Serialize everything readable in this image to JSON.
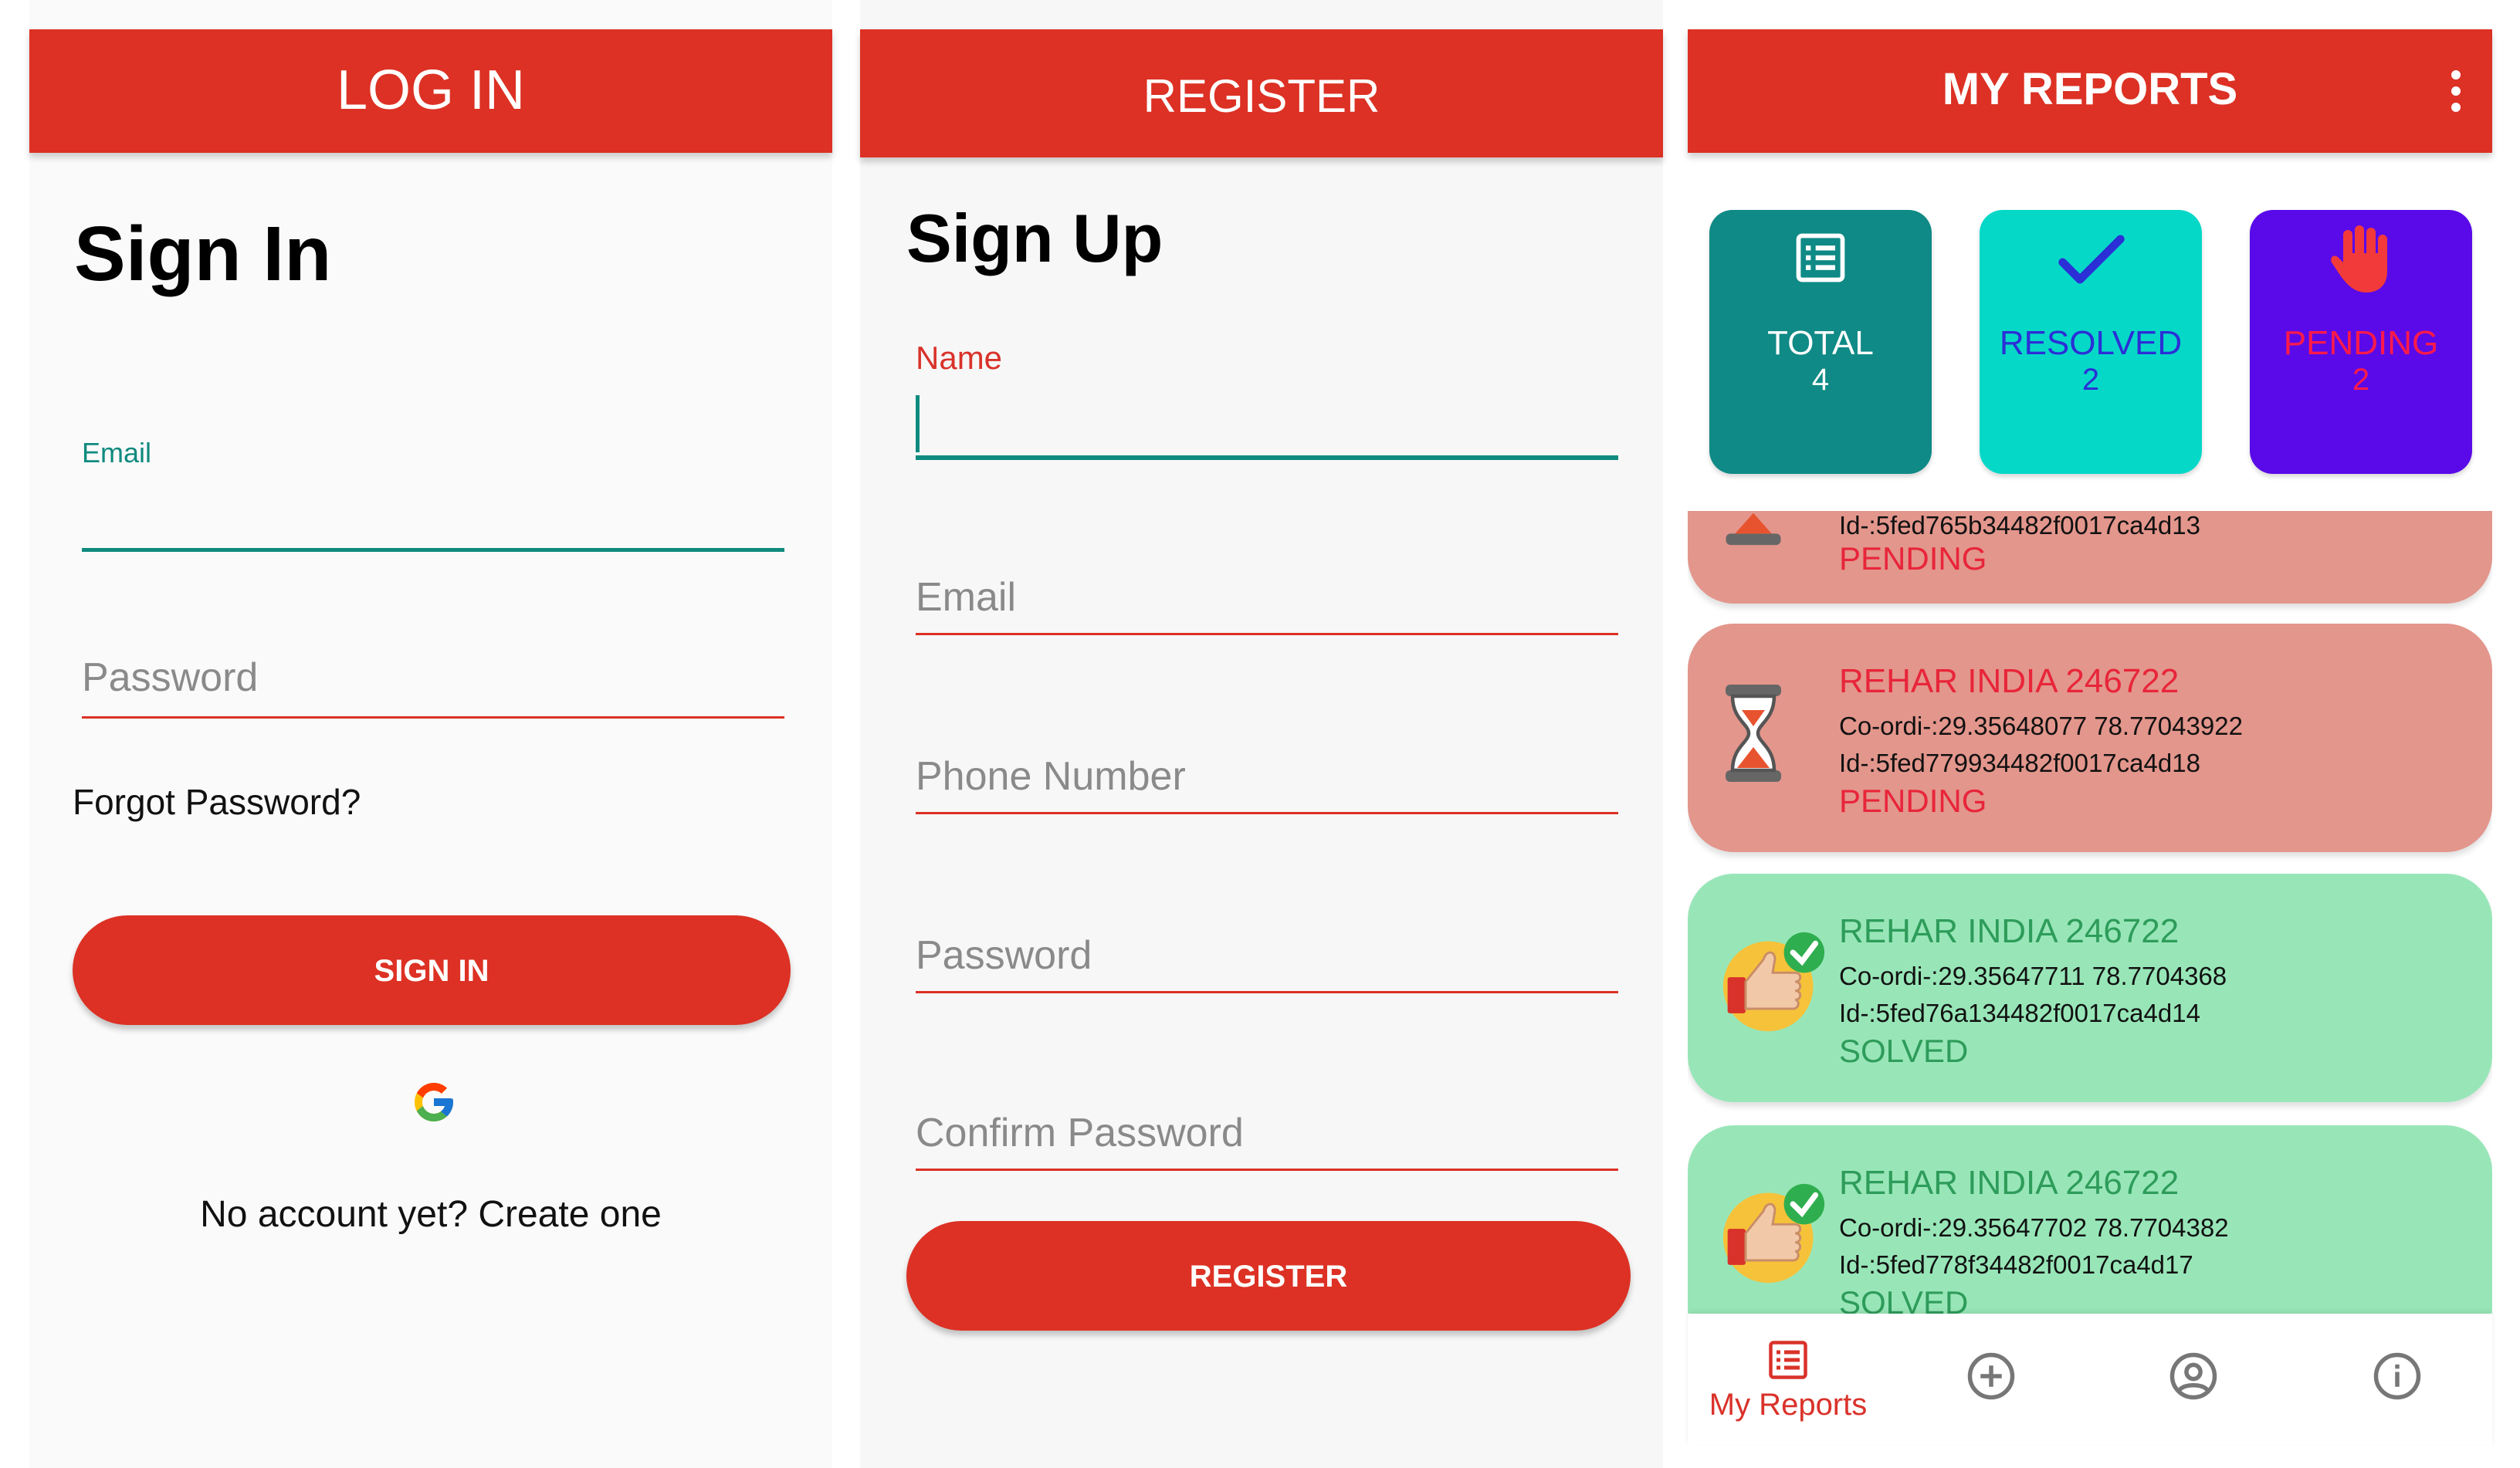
{
  "login": {
    "appbar_title": "LOG IN",
    "heading": "Sign In",
    "email_label": "Email",
    "password_placeholder": "Password",
    "forgot": "Forgot Password?",
    "sign_in_button": "SIGN IN",
    "create_account": "No account yet? Create one"
  },
  "register": {
    "appbar_title": "REGISTER",
    "heading": "Sign Up",
    "name_label": "Name",
    "email_placeholder": "Email",
    "phone_placeholder": "Phone Number",
    "password_placeholder": "Password",
    "confirm_placeholder": "Confirm Password",
    "register_button": "REGISTER"
  },
  "reports": {
    "appbar_title": "MY REPORTS",
    "stats": [
      {
        "label": "TOTAL",
        "count": "4",
        "color": "#0f8a86",
        "icon": "list-icon"
      },
      {
        "label": "RESOLVED",
        "count": "2",
        "color": "#06d8c8",
        "icon": "check-icon"
      },
      {
        "label": "PENDING",
        "count": "2",
        "color": "#5a0ae8",
        "icon": "hand-icon"
      }
    ],
    "cards": [
      {
        "id": "Id-:5fed765b34482f0017ca4d13",
        "status": "PENDING"
      },
      {
        "title": "REHAR INDIA 246722",
        "coords": "Co-ordi-:29.35648077 78.77043922",
        "id": "Id-:5fed779934482f0017ca4d18",
        "status": "PENDING"
      },
      {
        "title": "REHAR INDIA 246722",
        "coords": "Co-ordi-:29.35647711 78.7704368",
        "id": "Id-:5fed76a134482f0017ca4d14",
        "status": "SOLVED"
      },
      {
        "title": "REHAR INDIA 246722",
        "coords": "Co-ordi-:29.35647702 78.7704382",
        "id": "Id-:5fed778f34482f0017ca4d17",
        "status": "SOLVED"
      }
    ],
    "nav": {
      "my_reports": "My Reports"
    }
  }
}
